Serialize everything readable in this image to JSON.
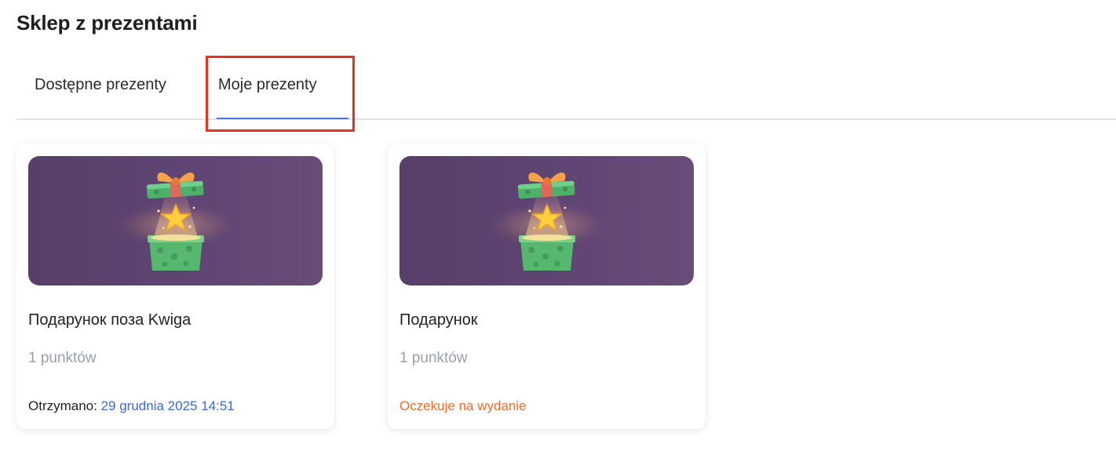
{
  "page": {
    "title": "Sklep z prezentami"
  },
  "tabs": [
    {
      "label": "Dostępne prezenty",
      "active": false
    },
    {
      "label": "Moje prezenty",
      "active": true
    }
  ],
  "cards": [
    {
      "image_icon": "gift-box-with-star-icon",
      "title": "Подарунок поза Kwiga",
      "points": "1 punktów",
      "received_label": "Otrzymano:",
      "received_date": "29 grudnia 2025 14:51"
    },
    {
      "image_icon": "gift-box-with-star-icon",
      "title": "Подарунок",
      "points": "1 punktów",
      "status": "Oczekuje na wydanie"
    }
  ],
  "colors": {
    "accent_blue": "#3a68e0",
    "status_orange": "#f26b2b",
    "highlight_red": "#e8321a",
    "card_image_bg": "#5e4473"
  }
}
